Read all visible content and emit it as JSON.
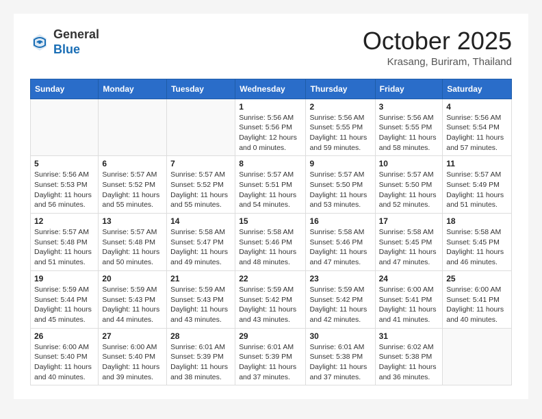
{
  "header": {
    "logo_general": "General",
    "logo_blue": "Blue",
    "month_title": "October 2025",
    "subtitle": "Krasang, Buriram, Thailand"
  },
  "weekdays": [
    "Sunday",
    "Monday",
    "Tuesday",
    "Wednesday",
    "Thursday",
    "Friday",
    "Saturday"
  ],
  "weeks": [
    [
      {
        "day": "",
        "info": ""
      },
      {
        "day": "",
        "info": ""
      },
      {
        "day": "",
        "info": ""
      },
      {
        "day": "1",
        "info": "Sunrise: 5:56 AM\nSunset: 5:56 PM\nDaylight: 12 hours\nand 0 minutes."
      },
      {
        "day": "2",
        "info": "Sunrise: 5:56 AM\nSunset: 5:55 PM\nDaylight: 11 hours\nand 59 minutes."
      },
      {
        "day": "3",
        "info": "Sunrise: 5:56 AM\nSunset: 5:55 PM\nDaylight: 11 hours\nand 58 minutes."
      },
      {
        "day": "4",
        "info": "Sunrise: 5:56 AM\nSunset: 5:54 PM\nDaylight: 11 hours\nand 57 minutes."
      }
    ],
    [
      {
        "day": "5",
        "info": "Sunrise: 5:56 AM\nSunset: 5:53 PM\nDaylight: 11 hours\nand 56 minutes."
      },
      {
        "day": "6",
        "info": "Sunrise: 5:57 AM\nSunset: 5:52 PM\nDaylight: 11 hours\nand 55 minutes."
      },
      {
        "day": "7",
        "info": "Sunrise: 5:57 AM\nSunset: 5:52 PM\nDaylight: 11 hours\nand 55 minutes."
      },
      {
        "day": "8",
        "info": "Sunrise: 5:57 AM\nSunset: 5:51 PM\nDaylight: 11 hours\nand 54 minutes."
      },
      {
        "day": "9",
        "info": "Sunrise: 5:57 AM\nSunset: 5:50 PM\nDaylight: 11 hours\nand 53 minutes."
      },
      {
        "day": "10",
        "info": "Sunrise: 5:57 AM\nSunset: 5:50 PM\nDaylight: 11 hours\nand 52 minutes."
      },
      {
        "day": "11",
        "info": "Sunrise: 5:57 AM\nSunset: 5:49 PM\nDaylight: 11 hours\nand 51 minutes."
      }
    ],
    [
      {
        "day": "12",
        "info": "Sunrise: 5:57 AM\nSunset: 5:48 PM\nDaylight: 11 hours\nand 51 minutes."
      },
      {
        "day": "13",
        "info": "Sunrise: 5:57 AM\nSunset: 5:48 PM\nDaylight: 11 hours\nand 50 minutes."
      },
      {
        "day": "14",
        "info": "Sunrise: 5:58 AM\nSunset: 5:47 PM\nDaylight: 11 hours\nand 49 minutes."
      },
      {
        "day": "15",
        "info": "Sunrise: 5:58 AM\nSunset: 5:46 PM\nDaylight: 11 hours\nand 48 minutes."
      },
      {
        "day": "16",
        "info": "Sunrise: 5:58 AM\nSunset: 5:46 PM\nDaylight: 11 hours\nand 47 minutes."
      },
      {
        "day": "17",
        "info": "Sunrise: 5:58 AM\nSunset: 5:45 PM\nDaylight: 11 hours\nand 47 minutes."
      },
      {
        "day": "18",
        "info": "Sunrise: 5:58 AM\nSunset: 5:45 PM\nDaylight: 11 hours\nand 46 minutes."
      }
    ],
    [
      {
        "day": "19",
        "info": "Sunrise: 5:59 AM\nSunset: 5:44 PM\nDaylight: 11 hours\nand 45 minutes."
      },
      {
        "day": "20",
        "info": "Sunrise: 5:59 AM\nSunset: 5:43 PM\nDaylight: 11 hours\nand 44 minutes."
      },
      {
        "day": "21",
        "info": "Sunrise: 5:59 AM\nSunset: 5:43 PM\nDaylight: 11 hours\nand 43 minutes."
      },
      {
        "day": "22",
        "info": "Sunrise: 5:59 AM\nSunset: 5:42 PM\nDaylight: 11 hours\nand 43 minutes."
      },
      {
        "day": "23",
        "info": "Sunrise: 5:59 AM\nSunset: 5:42 PM\nDaylight: 11 hours\nand 42 minutes."
      },
      {
        "day": "24",
        "info": "Sunrise: 6:00 AM\nSunset: 5:41 PM\nDaylight: 11 hours\nand 41 minutes."
      },
      {
        "day": "25",
        "info": "Sunrise: 6:00 AM\nSunset: 5:41 PM\nDaylight: 11 hours\nand 40 minutes."
      }
    ],
    [
      {
        "day": "26",
        "info": "Sunrise: 6:00 AM\nSunset: 5:40 PM\nDaylight: 11 hours\nand 40 minutes."
      },
      {
        "day": "27",
        "info": "Sunrise: 6:00 AM\nSunset: 5:40 PM\nDaylight: 11 hours\nand 39 minutes."
      },
      {
        "day": "28",
        "info": "Sunrise: 6:01 AM\nSunset: 5:39 PM\nDaylight: 11 hours\nand 38 minutes."
      },
      {
        "day": "29",
        "info": "Sunrise: 6:01 AM\nSunset: 5:39 PM\nDaylight: 11 hours\nand 37 minutes."
      },
      {
        "day": "30",
        "info": "Sunrise: 6:01 AM\nSunset: 5:38 PM\nDaylight: 11 hours\nand 37 minutes."
      },
      {
        "day": "31",
        "info": "Sunrise: 6:02 AM\nSunset: 5:38 PM\nDaylight: 11 hours\nand 36 minutes."
      },
      {
        "day": "",
        "info": ""
      }
    ]
  ]
}
